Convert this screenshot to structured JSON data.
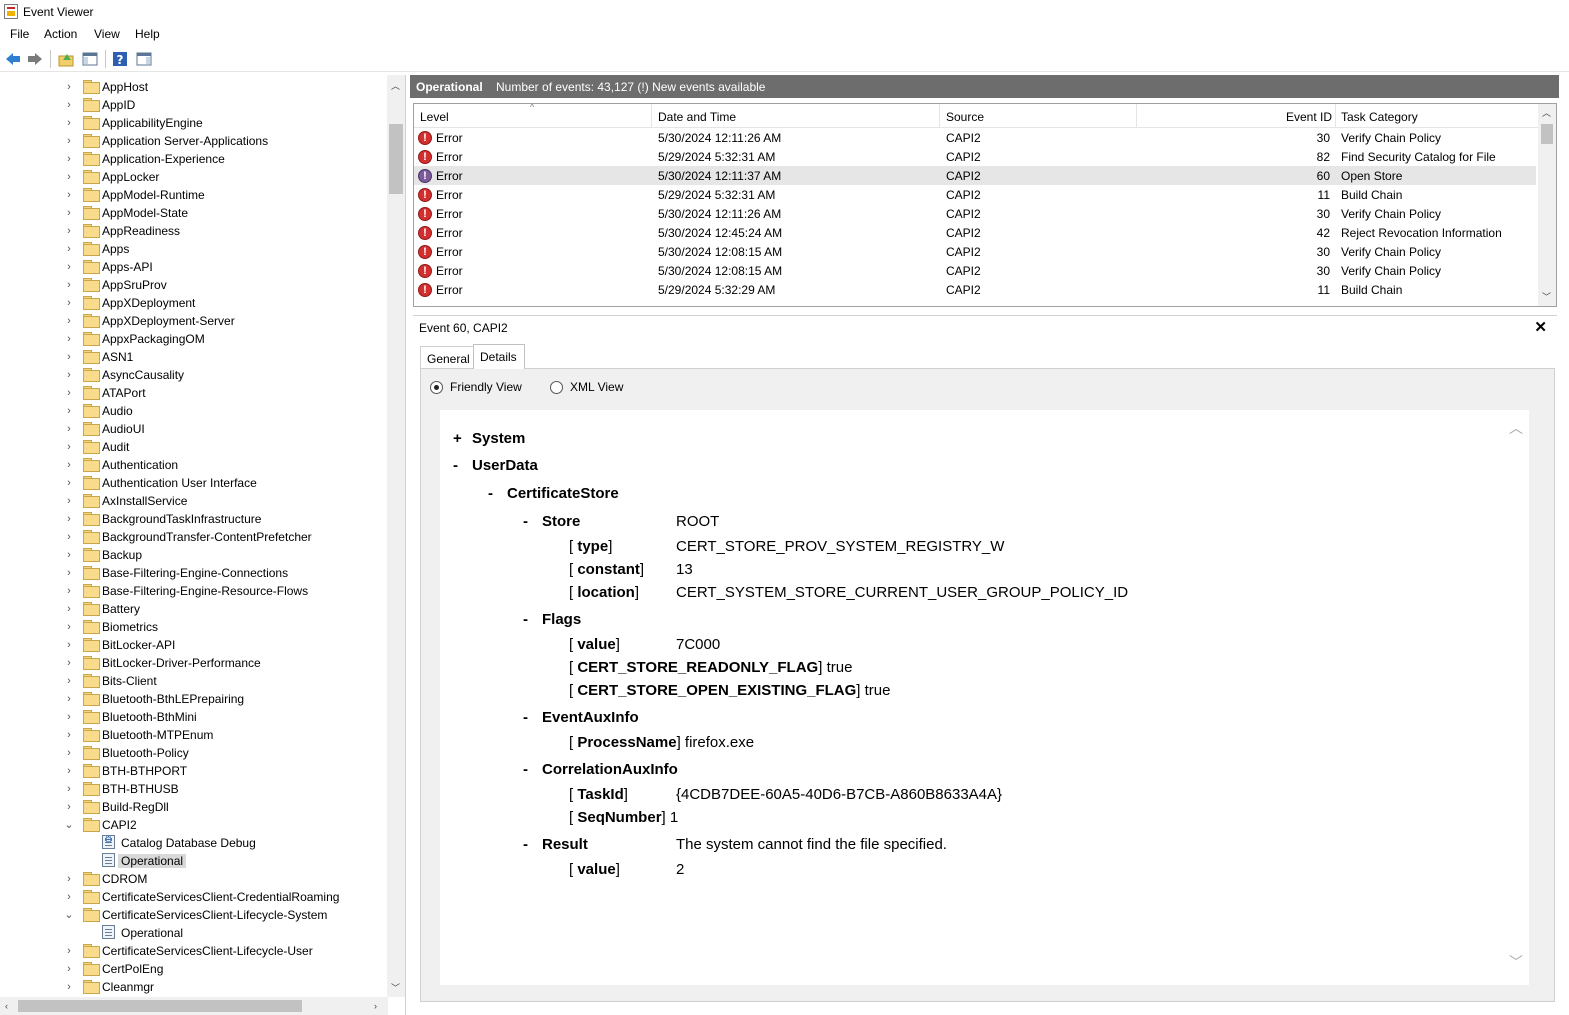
{
  "window": {
    "title": "Event Viewer"
  },
  "menu": [
    "File",
    "Action",
    "View",
    "Help"
  ],
  "tree": {
    "items": [
      {
        "label": "AppHost",
        "type": "folder",
        "expanded": false
      },
      {
        "label": "AppID",
        "type": "folder",
        "expanded": false
      },
      {
        "label": "ApplicabilityEngine",
        "type": "folder",
        "expanded": false
      },
      {
        "label": "Application Server-Applications",
        "type": "folder",
        "expanded": false
      },
      {
        "label": "Application-Experience",
        "type": "folder",
        "expanded": false
      },
      {
        "label": "AppLocker",
        "type": "folder",
        "expanded": false
      },
      {
        "label": "AppModel-Runtime",
        "type": "folder",
        "expanded": false
      },
      {
        "label": "AppModel-State",
        "type": "folder",
        "expanded": false
      },
      {
        "label": "AppReadiness",
        "type": "folder",
        "expanded": false
      },
      {
        "label": "Apps",
        "type": "folder",
        "expanded": false
      },
      {
        "label": "Apps-API",
        "type": "folder",
        "expanded": false
      },
      {
        "label": "AppSruProv",
        "type": "folder",
        "expanded": false
      },
      {
        "label": "AppXDeployment",
        "type": "folder",
        "expanded": false
      },
      {
        "label": "AppXDeployment-Server",
        "type": "folder",
        "expanded": false
      },
      {
        "label": "AppxPackagingOM",
        "type": "folder",
        "expanded": false
      },
      {
        "label": "ASN1",
        "type": "folder",
        "expanded": false
      },
      {
        "label": "AsyncCausality",
        "type": "folder",
        "expanded": false
      },
      {
        "label": "ATAPort",
        "type": "folder",
        "expanded": false
      },
      {
        "label": "Audio",
        "type": "folder",
        "expanded": false
      },
      {
        "label": "AudioUI",
        "type": "folder",
        "expanded": false
      },
      {
        "label": "Audit",
        "type": "folder",
        "expanded": false
      },
      {
        "label": "Authentication",
        "type": "folder",
        "expanded": false
      },
      {
        "label": "Authentication User Interface",
        "type": "folder",
        "expanded": false
      },
      {
        "label": "AxInstallService",
        "type": "folder",
        "expanded": false
      },
      {
        "label": "BackgroundTaskInfrastructure",
        "type": "folder",
        "expanded": false
      },
      {
        "label": "BackgroundTransfer-ContentPrefetcher",
        "type": "folder",
        "expanded": false
      },
      {
        "label": "Backup",
        "type": "folder",
        "expanded": false
      },
      {
        "label": "Base-Filtering-Engine-Connections",
        "type": "folder",
        "expanded": false
      },
      {
        "label": "Base-Filtering-Engine-Resource-Flows",
        "type": "folder",
        "expanded": false
      },
      {
        "label": "Battery",
        "type": "folder",
        "expanded": false
      },
      {
        "label": "Biometrics",
        "type": "folder",
        "expanded": false
      },
      {
        "label": "BitLocker-API",
        "type": "folder",
        "expanded": false
      },
      {
        "label": "BitLocker-Driver-Performance",
        "type": "folder",
        "expanded": false
      },
      {
        "label": "Bits-Client",
        "type": "folder",
        "expanded": false
      },
      {
        "label": "Bluetooth-BthLEPrepairing",
        "type": "folder",
        "expanded": false
      },
      {
        "label": "Bluetooth-BthMini",
        "type": "folder",
        "expanded": false
      },
      {
        "label": "Bluetooth-MTPEnum",
        "type": "folder",
        "expanded": false
      },
      {
        "label": "Bluetooth-Policy",
        "type": "folder",
        "expanded": false
      },
      {
        "label": "BTH-BTHPORT",
        "type": "folder",
        "expanded": false
      },
      {
        "label": "BTH-BTHUSB",
        "type": "folder",
        "expanded": false
      },
      {
        "label": "Build-RegDll",
        "type": "folder",
        "expanded": false
      },
      {
        "label": "CAPI2",
        "type": "folder",
        "expanded": true
      },
      {
        "label": "Catalog Database Debug",
        "type": "debuglog",
        "child": true
      },
      {
        "label": "Operational",
        "type": "log",
        "child": true,
        "selected": true
      },
      {
        "label": "CDROM",
        "type": "folder",
        "expanded": false
      },
      {
        "label": "CertificateServicesClient-CredentialRoaming",
        "type": "folder",
        "expanded": false
      },
      {
        "label": "CertificateServicesClient-Lifecycle-System",
        "type": "folder",
        "expanded": true
      },
      {
        "label": "Operational",
        "type": "log",
        "child": true
      },
      {
        "label": "CertificateServicesClient-Lifecycle-User",
        "type": "folder",
        "expanded": false
      },
      {
        "label": "CertPolEng",
        "type": "folder",
        "expanded": false
      },
      {
        "label": "Cleanmgr",
        "type": "folder",
        "expanded": false
      }
    ]
  },
  "log_header": {
    "name": "Operational",
    "count_text": "Number of events: 43,127 (!) New events available"
  },
  "grid": {
    "columns": [
      "Level",
      "Date and Time",
      "Source",
      "Event ID",
      "Task Category"
    ],
    "rows": [
      {
        "level": "Error",
        "date": "5/30/2024 12:11:26 AM",
        "source": "CAPI2",
        "id": "30",
        "task": "Verify Chain Policy"
      },
      {
        "level": "Error",
        "date": "5/29/2024 5:32:31 AM",
        "source": "CAPI2",
        "id": "82",
        "task": "Find Security Catalog for File"
      },
      {
        "level": "Error",
        "date": "5/30/2024 12:11:37 AM",
        "source": "CAPI2",
        "id": "60",
        "task": "Open Store",
        "selected": true
      },
      {
        "level": "Error",
        "date": "5/29/2024 5:32:31 AM",
        "source": "CAPI2",
        "id": "11",
        "task": "Build Chain"
      },
      {
        "level": "Error",
        "date": "5/30/2024 12:11:26 AM",
        "source": "CAPI2",
        "id": "30",
        "task": "Verify Chain Policy"
      },
      {
        "level": "Error",
        "date": "5/30/2024 12:45:24 AM",
        "source": "CAPI2",
        "id": "42",
        "task": "Reject Revocation Information"
      },
      {
        "level": "Error",
        "date": "5/30/2024 12:08:15 AM",
        "source": "CAPI2",
        "id": "30",
        "task": "Verify Chain Policy"
      },
      {
        "level": "Error",
        "date": "5/30/2024 12:08:15 AM",
        "source": "CAPI2",
        "id": "30",
        "task": "Verify Chain Policy"
      },
      {
        "level": "Error",
        "date": "5/29/2024 5:32:29 AM",
        "source": "CAPI2",
        "id": "11",
        "task": "Build Chain"
      }
    ]
  },
  "detail": {
    "title": "Event 60, CAPI2",
    "close": "✕",
    "tabs": [
      "General",
      "Details"
    ],
    "view_options": [
      "Friendly View",
      "XML View"
    ],
    "tree": {
      "system": "System",
      "userdata": "UserData",
      "certstore": "CertificateStore",
      "store_label": "Store",
      "store_value": "ROOT",
      "type_key": "type",
      "type_value": "CERT_STORE_PROV_SYSTEM_REGISTRY_W",
      "constant_key": "constant",
      "constant_value": "13",
      "location_key": "location",
      "location_value": "CERT_SYSTEM_STORE_CURRENT_USER_GROUP_POLICY_ID",
      "flags_label": "Flags",
      "value_key": "value",
      "flags_value": "7C000",
      "readonly_key": "CERT_STORE_READONLY_FLAG",
      "readonly_value": "true",
      "openexisting_key": "CERT_STORE_OPEN_EXISTING_FLAG",
      "openexisting_value": "true",
      "eventaux_label": "EventAuxInfo",
      "processname_key": "ProcessName",
      "processname_value": "firefox.exe",
      "corr_label": "CorrelationAuxInfo",
      "taskid_key": "TaskId",
      "taskid_value": "{4CDB7DEE-60A5-40D6-B7CB-A860B8633A4A}",
      "seq_key": "SeqNumber",
      "seq_value": "1",
      "result_label": "Result",
      "result_value": "The system cannot find the file specified.",
      "result_sub_value": "2"
    }
  }
}
